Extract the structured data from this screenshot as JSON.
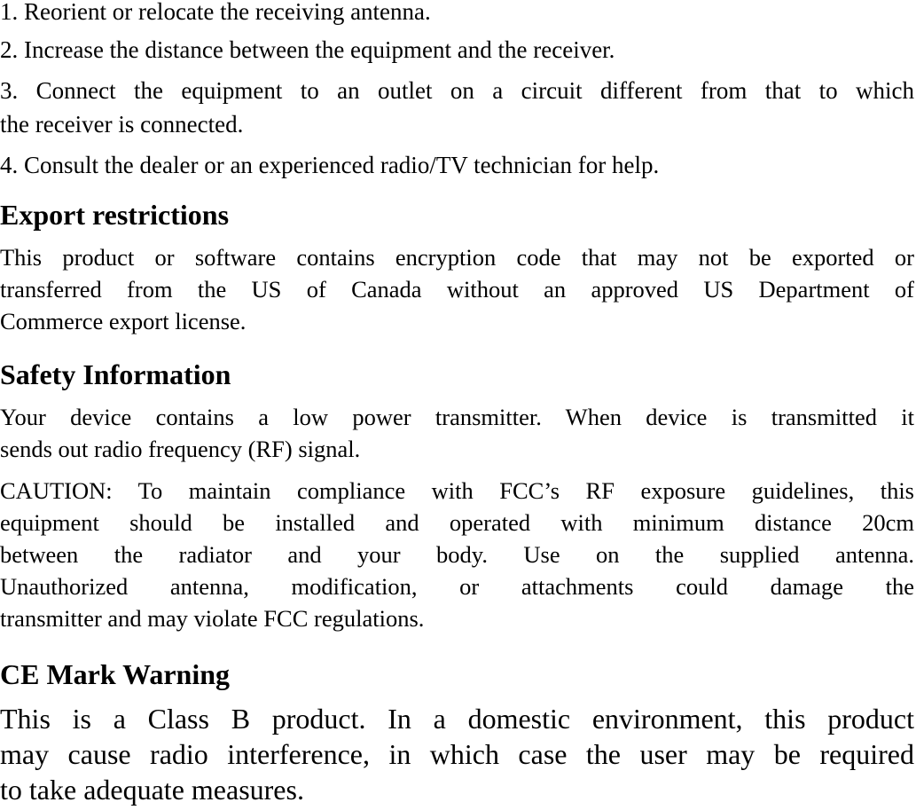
{
  "fcc_steps": [
    "1. Reorient or relocate the receiving antenna.",
    "2. Increase the distance between the equipment and the receiver.",
    "3. Connect the equipment to an outlet on a circuit different from that to which",
    "the receiver is connected.",
    "4. Consult the dealer or an experienced radio/TV technician for help."
  ],
  "export": {
    "heading": "Export restrictions",
    "lines": [
      "This product or software contains encryption code that may not be exported or",
      "transferred from the US of Canada without an approved US Department of",
      "Commerce export license."
    ]
  },
  "safety": {
    "heading": "Safety Information",
    "intro_lines": [
      "Your device contains a low power transmitter. When device is transmitted it",
      "sends out radio frequency (RF) signal."
    ],
    "caution_lines": [
      "CAUTION: To maintain compliance with FCC’s RF exposure guidelines, this",
      "equipment should be installed and operated with minimum distance 20cm",
      "between the radiator and your body. Use on the supplied antenna.",
      "Unauthorized antenna, modification, or attachments could damage the",
      "transmitter and may violate FCC regulations."
    ]
  },
  "ce": {
    "heading": "CE Mark Warning",
    "lines": [
      "This is a Class B product. In a domestic environment, this product",
      "may cause radio interference, in which case the user may be required",
      "to take adequate measures."
    ]
  }
}
